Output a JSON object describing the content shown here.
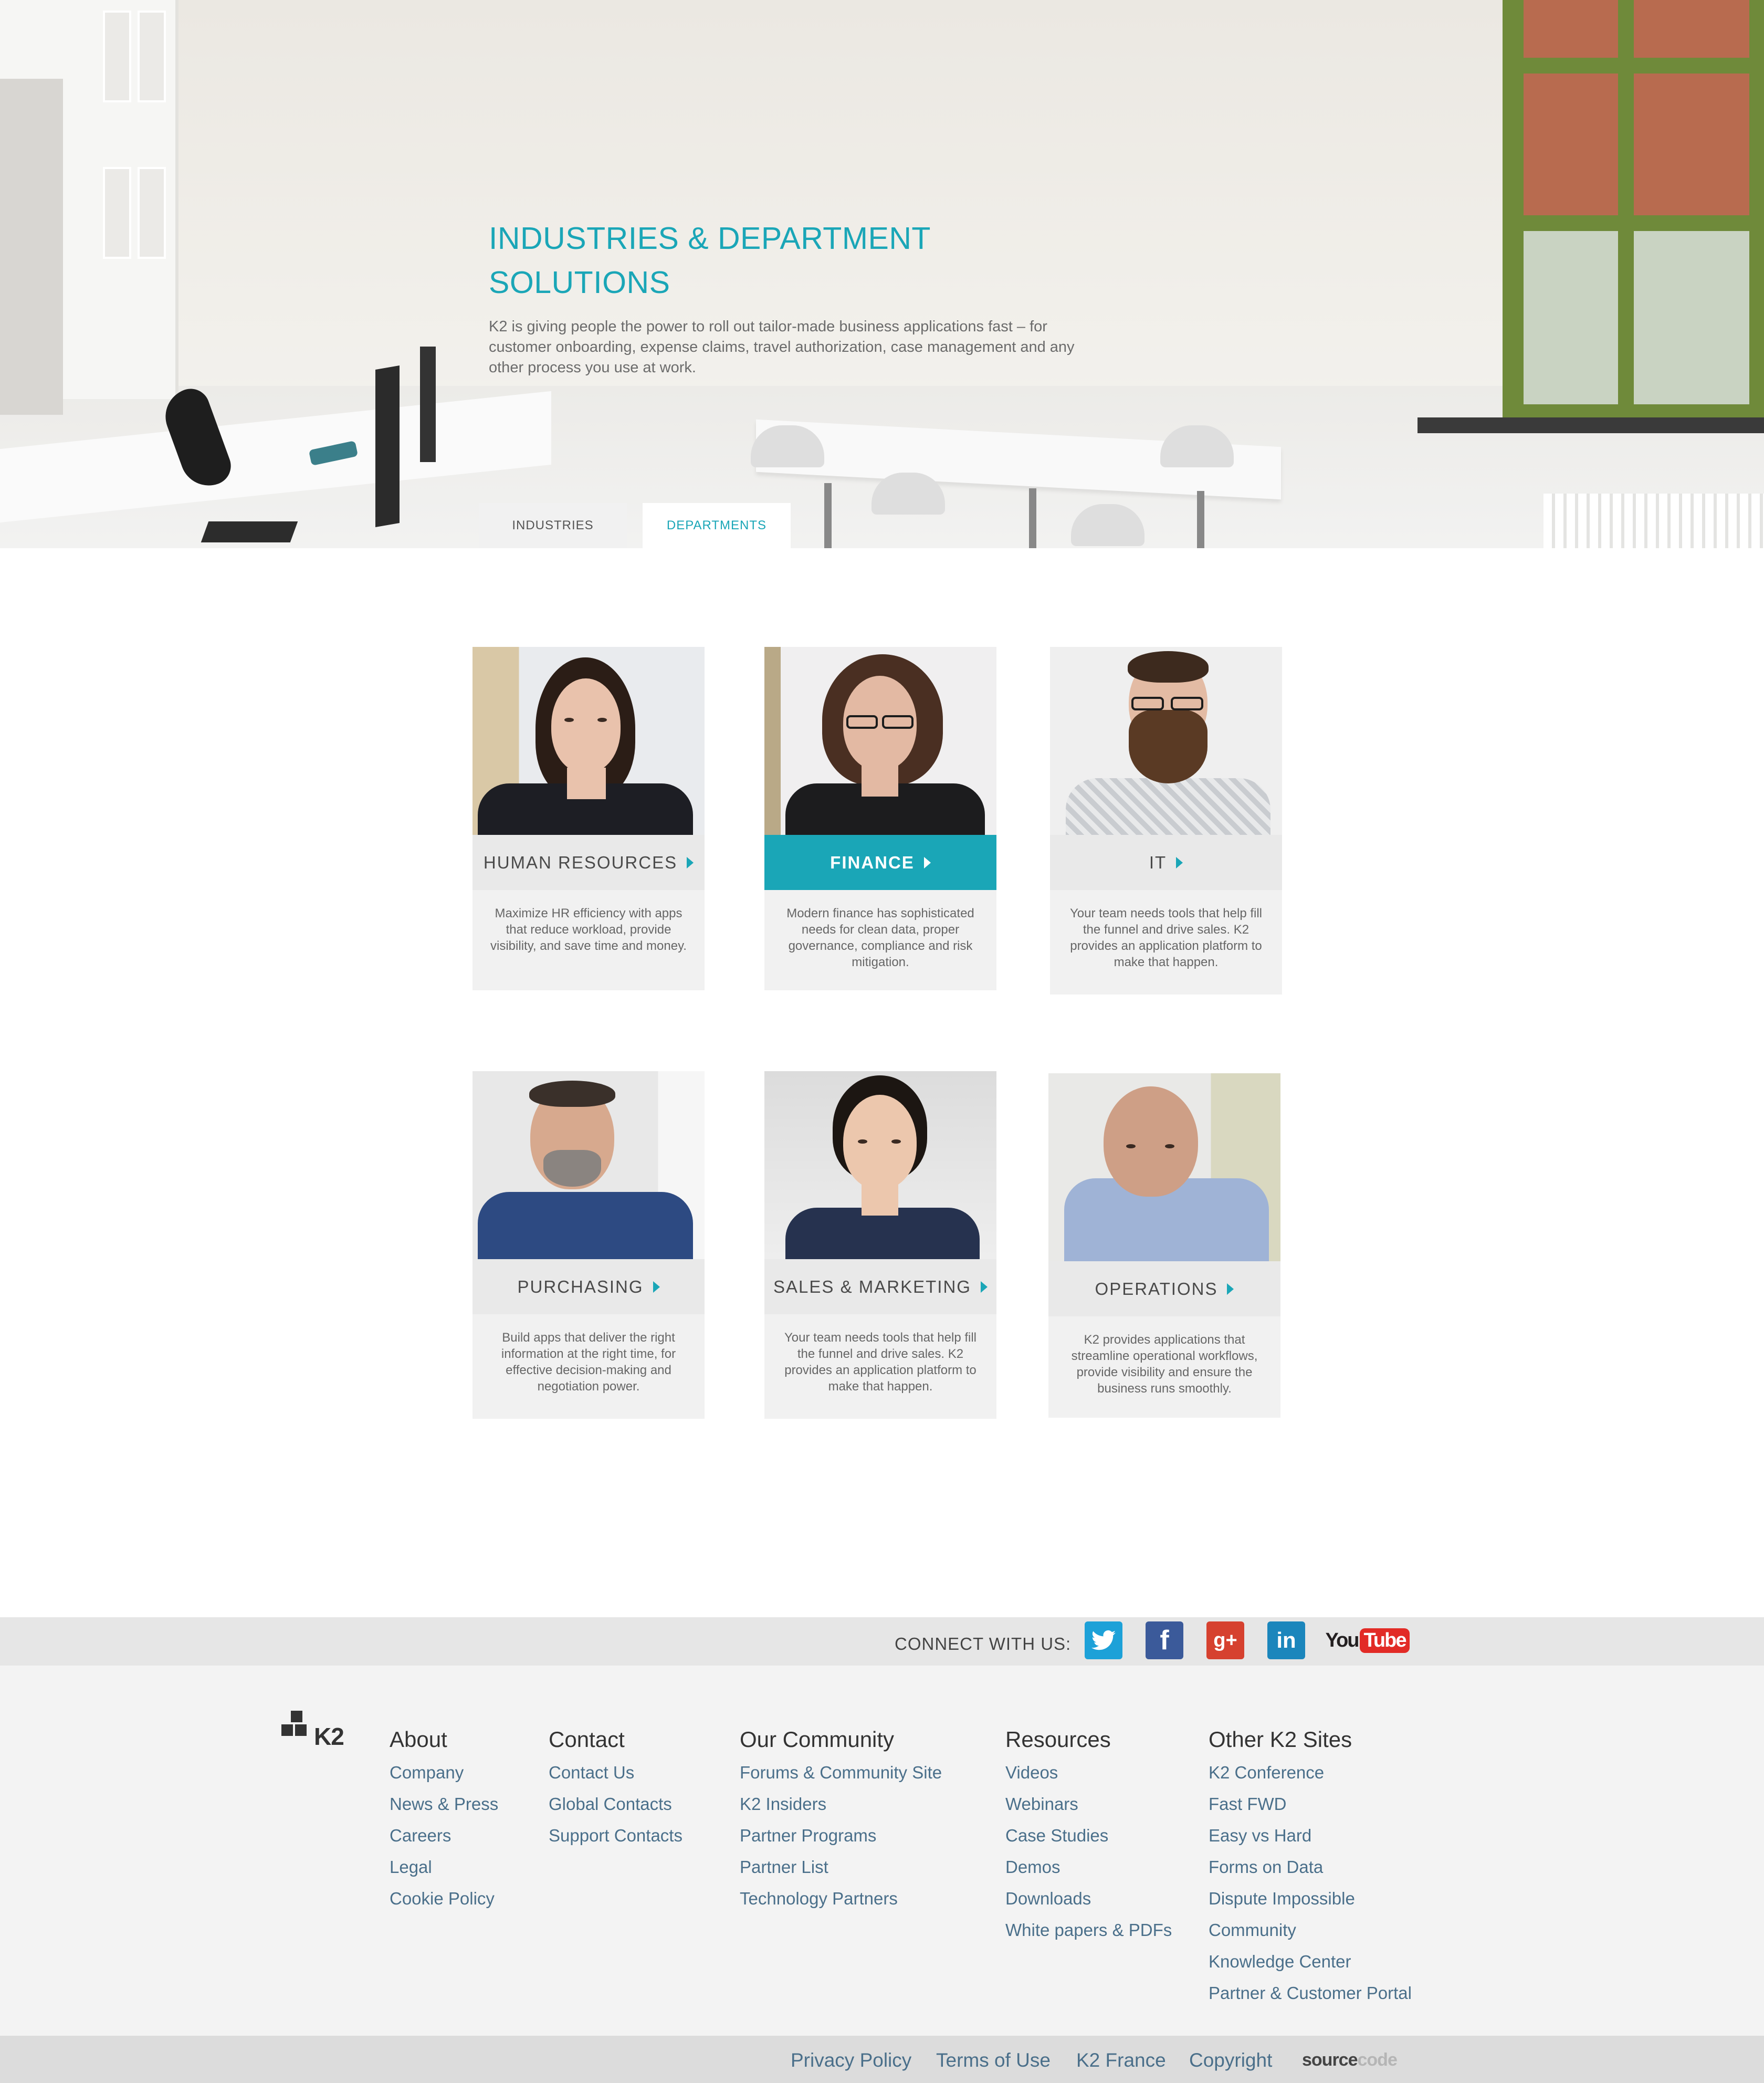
{
  "hero": {
    "title_line1": "INDUSTRIES & DEPARTMENT",
    "title_line2": "SOLUTIONS",
    "description": "K2 is giving people the power to roll out tailor-made business applications fast – for customer onboarding, expense claims, travel authorization, case management and any other process you use at work."
  },
  "tabs": [
    {
      "label": "INDUSTRIES",
      "active": false
    },
    {
      "label": "DEPARTMENTS",
      "active": true
    }
  ],
  "cards": [
    {
      "label": "HUMAN RESOURCES",
      "description": "Maximize HR efficiency with apps that reduce workload, provide visibility, and save time and money.",
      "active": false
    },
    {
      "label": "FINANCE",
      "description": "Modern finance has sophisticated needs for clean data, proper governance, compliance and risk mitigation.",
      "active": true
    },
    {
      "label": "IT",
      "description": "Your team needs tools that help fill the funnel and drive sales. K2 provides an application platform to make that happen.",
      "active": false
    },
    {
      "label": "PURCHASING",
      "description": "Build apps that deliver the right information at the right time, for effective decision-making and negotiation power.",
      "active": false
    },
    {
      "label": "SALES & MARKETING",
      "description": "Your team needs tools that help fill the funnel and drive sales. K2 provides an application platform to make that happen.",
      "active": false
    },
    {
      "label": "OPERATIONS",
      "description": "K2 provides applications that streamline operational workflows, provide visibility and ensure the business runs smoothly.",
      "active": false
    }
  ],
  "connect": {
    "label": "CONNECT WITH US:",
    "networks": [
      {
        "name": "twitter-icon",
        "glyph": "🐦",
        "color": "#1da1d8"
      },
      {
        "name": "facebook-icon",
        "glyph": "f",
        "color": "#3b5a9a"
      },
      {
        "name": "google-plus-icon",
        "glyph": "g+",
        "color": "#d6412f"
      },
      {
        "name": "linkedin-icon",
        "glyph": "in",
        "color": "#1b86bc"
      },
      {
        "name": "youtube-icon",
        "glyph": "YouTube",
        "color": "#e22b26"
      }
    ]
  },
  "footer": {
    "logo_text": "K2",
    "columns": [
      {
        "title": "About",
        "links": [
          "Company",
          "News & Press",
          "Careers",
          "Legal",
          "Cookie Policy"
        ]
      },
      {
        "title": "Contact",
        "links": [
          "Contact Us",
          "Global Contacts",
          "Support Contacts"
        ]
      },
      {
        "title": "Our Community",
        "links": [
          "Forums & Community Site",
          "K2 Insiders",
          "Partner Programs",
          "Partner List",
          "Technology Partners"
        ]
      },
      {
        "title": "Resources",
        "links": [
          "Videos",
          "Webinars",
          "Case Studies",
          "Demos",
          "Downloads",
          "White papers & PDFs"
        ]
      },
      {
        "title": "Other K2 Sites",
        "links": [
          "K2 Conference",
          "Fast FWD",
          "Easy vs Hard",
          "Forms on Data",
          "Dispute Impossible",
          "Community",
          "Knowledge Center",
          "Partner & Customer Portal"
        ]
      }
    ],
    "bottom_links": [
      "Privacy Policy",
      "Terms of Use",
      "K2 France",
      "Copyright"
    ],
    "credit_part1": "source",
    "credit_part2": "code"
  }
}
